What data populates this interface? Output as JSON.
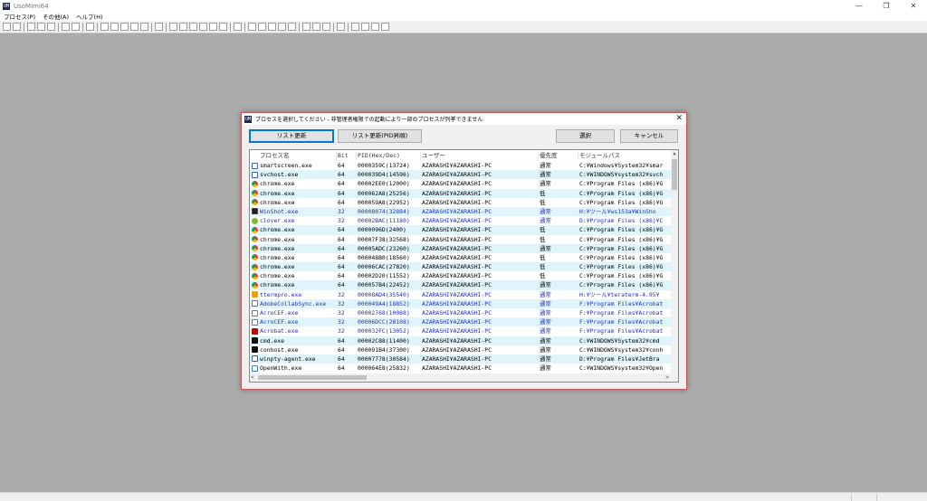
{
  "app": {
    "icon_text": "UM",
    "title": "UsoMimi64",
    "window_buttons": [
      "—",
      "❐",
      "✕"
    ]
  },
  "menu": [
    "プロセス(P)",
    "その他(A)",
    "ヘルプ(H)"
  ],
  "toolbar_icons": [
    "info-icon",
    "list-icon",
    "hammer-icon",
    "refresh-icon",
    "refresh-alt-icon",
    "back-icon",
    "forward-icon",
    "page-icon",
    "window-icon",
    "window-alt-icon",
    "window-alt2-icon",
    "window-alt3-icon",
    "window-alt4-icon",
    "grid-icon",
    "frame-icon",
    "frame-alt-icon",
    "globe-icon",
    "image-icon",
    "bars-icon",
    "panel-icon",
    "gear-icon",
    "find-icon",
    "find-next-icon",
    "find-prev-icon",
    "grid-search-icon",
    "tree-icon",
    "square-icon",
    "screen-icon",
    "screen-alt-icon",
    "pin-icon",
    "copy-icon",
    "paste-icon",
    "list-alt-icon",
    "window-small-icon"
  ],
  "dialog": {
    "icon_text": "UM",
    "title": "プロセスを選択してください - 非管理者権限での起動により一部のプロセスが列挙できません",
    "close": "✕",
    "buttons": {
      "refresh": "リスト更新",
      "refresh_pid": "リスト更新(PID昇順)",
      "select": "選択",
      "cancel": "キャンセル"
    },
    "columns": [
      "プロセス名",
      "Bit",
      "PID(Hex/Dec)",
      "ユーザー",
      "優先度",
      "モジュールパス"
    ],
    "rows": [
      {
        "icon": "win",
        "name": "smartscreen.exe",
        "bit": "64",
        "pid": "0000359C(13724)",
        "user": "AZARASHI¥AZARASHI-PC",
        "prio": "通常",
        "path": "C:¥Windows¥System32¥smar"
      },
      {
        "icon": "win",
        "name": "svchost.exe",
        "bit": "64",
        "pid": "000039D4(14596)",
        "user": "AZARASHI¥AZARASHI-PC",
        "prio": "通常",
        "path": "C:¥WINDOWS¥system32¥svch"
      },
      {
        "icon": "chrome",
        "name": "chrome.exe",
        "bit": "64",
        "pid": "00002EE0(12000)",
        "user": "AZARASHI¥AZARASHI-PC",
        "prio": "通常",
        "path": "C:¥Program Files (x86)¥G"
      },
      {
        "icon": "chrome",
        "name": "chrome.exe",
        "bit": "64",
        "pid": "000062A8(25256)",
        "user": "AZARASHI¥AZARASHI-PC",
        "prio": "低",
        "path": "C:¥Program Files (x86)¥G"
      },
      {
        "icon": "chrome",
        "name": "chrome.exe",
        "bit": "64",
        "pid": "000059A8(22952)",
        "user": "AZARASHI¥AZARASHI-PC",
        "prio": "低",
        "path": "C:¥Program Files (x86)¥G"
      },
      {
        "icon": "winshot",
        "name": "WinShot.exe",
        "bit": "32",
        "pid": "00008074(32884)",
        "user": "AZARASHI¥AZARASHI-PC",
        "prio": "通常",
        "path": "H:¥ツール¥ws153a¥WinSho",
        "blue": true
      },
      {
        "icon": "clover",
        "name": "clover.exe",
        "bit": "32",
        "pid": "00002BAC(11180)",
        "user": "AZARASHI¥AZARASHI-PC",
        "prio": "通常",
        "path": "D:¥Program Files (x86)¥C",
        "blue": true
      },
      {
        "icon": "chrome",
        "name": "chrome.exe",
        "bit": "64",
        "pid": "0000096D(2400)",
        "user": "AZARASHI¥AZARASHI-PC",
        "prio": "低",
        "path": "C:¥Program Files (x86)¥G"
      },
      {
        "icon": "chrome",
        "name": "chrome.exe",
        "bit": "64",
        "pid": "00007F38(32568)",
        "user": "AZARASHI¥AZARASHI-PC",
        "prio": "低",
        "path": "C:¥Program Files (x86)¥G"
      },
      {
        "icon": "chrome",
        "name": "chrome.exe",
        "bit": "64",
        "pid": "00005ADC(23260)",
        "user": "AZARASHI¥AZARASHI-PC",
        "prio": "通常",
        "path": "C:¥Program Files (x86)¥G"
      },
      {
        "icon": "chrome",
        "name": "chrome.exe",
        "bit": "64",
        "pid": "000048B0(18560)",
        "user": "AZARASHI¥AZARASHI-PC",
        "prio": "低",
        "path": "C:¥Program Files (x86)¥G"
      },
      {
        "icon": "chrome",
        "name": "chrome.exe",
        "bit": "64",
        "pid": "00006CAC(27820)",
        "user": "AZARASHI¥AZARASHI-PC",
        "prio": "低",
        "path": "C:¥Program Files (x86)¥G"
      },
      {
        "icon": "chrome",
        "name": "chrome.exe",
        "bit": "64",
        "pid": "00002D20(11552)",
        "user": "AZARASHI¥AZARASHI-PC",
        "prio": "低",
        "path": "C:¥Program Files (x86)¥G"
      },
      {
        "icon": "chrome",
        "name": "chrome.exe",
        "bit": "64",
        "pid": "000057B4(22452)",
        "user": "AZARASHI¥AZARASHI-PC",
        "prio": "通常",
        "path": "C:¥Program Files (x86)¥G"
      },
      {
        "icon": "tt",
        "name": "ttermpro.exe",
        "bit": "32",
        "pid": "00008AD4(35540)",
        "user": "AZARASHI¥AZARASHI-PC",
        "prio": "通常",
        "path": "H:¥ツール¥teraterm-4.95¥",
        "blue": true
      },
      {
        "icon": "adobe",
        "name": "AdobeCollabSync.exe",
        "bit": "32",
        "pid": "000049A4(18852)",
        "user": "AZARASHI¥AZARASHI-PC",
        "prio": "通常",
        "path": "F:¥Program Files¥Acrobat",
        "blue": true
      },
      {
        "icon": "adobe",
        "name": "AcroCEF.exe",
        "bit": "32",
        "pid": "00002768(10088)",
        "user": "AZARASHI¥AZARASHI-PC",
        "prio": "通常",
        "path": "F:¥Program Files¥Acrobat",
        "blue": true
      },
      {
        "icon": "adobe",
        "name": "AcroCEF.exe",
        "bit": "32",
        "pid": "00006DCC(28108)",
        "user": "AZARASHI¥AZARASHI-PC",
        "prio": "通常",
        "path": "F:¥Program Files¥Acrobat",
        "blue": true
      },
      {
        "icon": "acrobat",
        "name": "Acrobat.exe",
        "bit": "32",
        "pid": "000032FC(13052)",
        "user": "AZARASHI¥AZARASHI-PC",
        "prio": "通常",
        "path": "F:¥Program Files¥Acrobat",
        "blue": true
      },
      {
        "icon": "cmd",
        "name": "cmd.exe",
        "bit": "64",
        "pid": "00002C88(11400)",
        "user": "AZARASHI¥AZARASHI-PC",
        "prio": "通常",
        "path": "C:¥WINDOWS¥System32¥cmd"
      },
      {
        "icon": "cmd",
        "name": "conhost.exe",
        "bit": "64",
        "pid": "000091B4(37300)",
        "user": "AZARASHI¥AZARASHI-PC",
        "prio": "通常",
        "path": "C:¥WINDOWS¥system32¥conh"
      },
      {
        "icon": "win",
        "name": "winpty-agent.exe",
        "bit": "64",
        "pid": "00007778(30584)",
        "user": "AZARASHI¥AZARASHI-PC",
        "prio": "通常",
        "path": "D:¥Program Files¥JetBra"
      },
      {
        "icon": "openwith",
        "name": "OpenWith.exe",
        "bit": "64",
        "pid": "000064E8(25832)",
        "user": "AZARASHI¥AZARASHI-PC",
        "prio": "通常",
        "path": "C:¥WINDOWS¥system32¥Open"
      }
    ],
    "scroll": {
      "up": "▲",
      "left": "<",
      "right": ">"
    }
  },
  "colors": {
    "desktop": "#ababab",
    "alt_row": "#dff5fb",
    "bit32_text": "#1f2ec8",
    "dialog_border": "#c85a5a",
    "focus": "#0078d7"
  }
}
